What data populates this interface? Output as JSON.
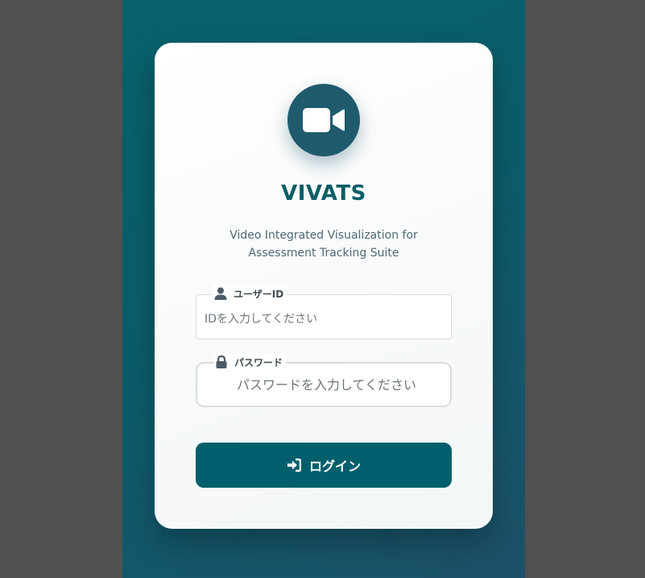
{
  "app": {
    "title": "VIVATS",
    "subtitle": "Video Integrated Visualization for Assessment Tracking Suite",
    "logo_icon": "video-camera-icon"
  },
  "form": {
    "user_id": {
      "label": "ユーザーID",
      "placeholder": "IDを入力してください",
      "value": "",
      "icon": "user-icon"
    },
    "password": {
      "label": "パスワード",
      "placeholder": "パスワードを入力してください",
      "value": "",
      "icon": "lock-icon"
    },
    "login": {
      "label": "ログイン",
      "icon": "sign-in-icon"
    }
  },
  "colors": {
    "background": "#505050",
    "panel_gradient_start": "#07616c",
    "panel_gradient_end": "#1d5169",
    "logo_circle": "#1f5a6d",
    "title": "#0b5d66",
    "subtitle": "#4e6878",
    "button": "#005f6c",
    "button_text": "#ffffff"
  }
}
